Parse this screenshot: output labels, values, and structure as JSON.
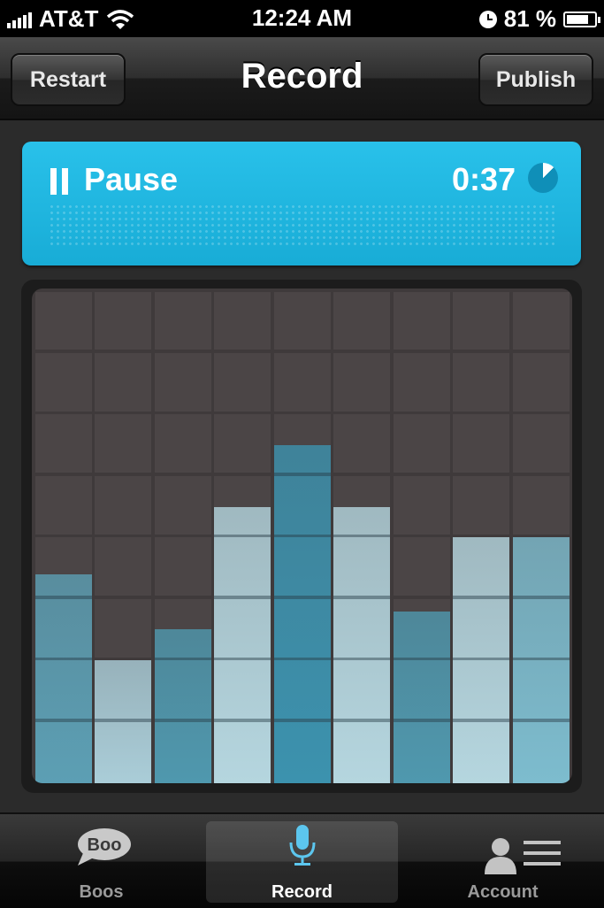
{
  "status_bar": {
    "carrier": "AT&T",
    "time": "12:24 AM",
    "battery_percent": "81 %",
    "battery_level": 0.81,
    "signal_bars": 5,
    "icons": [
      "signal-icon",
      "wifi-icon",
      "clock-icon",
      "battery-icon"
    ]
  },
  "nav": {
    "title": "Record",
    "left_button": "Restart",
    "right_button": "Publish"
  },
  "recorder": {
    "pause_label": "Pause",
    "elapsed": "0:37",
    "elapsed_fraction": 0.125,
    "accent_color": "#1cb4e0"
  },
  "equalizer": {
    "rows": 8,
    "columns": 9,
    "levels": [
      3.4,
      2.0,
      2.5,
      4.5,
      5.5,
      4.5,
      2.8,
      4.0,
      4.0
    ],
    "colors": {
      "bar_dark": "#4fa5bd",
      "bar_light": "#c4dee6",
      "bar_mid": "#7cc4d8",
      "bar_center": "#3c9ab5",
      "empty_cell": "#4b4546"
    },
    "bar_palette": [
      "#5c9fb4",
      "#aacdd8",
      "#4f98ae",
      "#b5d6df",
      "#3c92ae",
      "#b5d6df",
      "#4f98ae",
      "#b5d6df",
      "#7dbcce"
    ]
  },
  "tab_bar": {
    "tabs": [
      {
        "label": "Boos",
        "icon": "boo-speech-bubble-icon",
        "active": false
      },
      {
        "label": "Record",
        "icon": "microphone-icon",
        "active": true
      },
      {
        "label": "Account",
        "icon": "account-icon",
        "active": false
      }
    ],
    "boo_icon_text": "Boo"
  }
}
